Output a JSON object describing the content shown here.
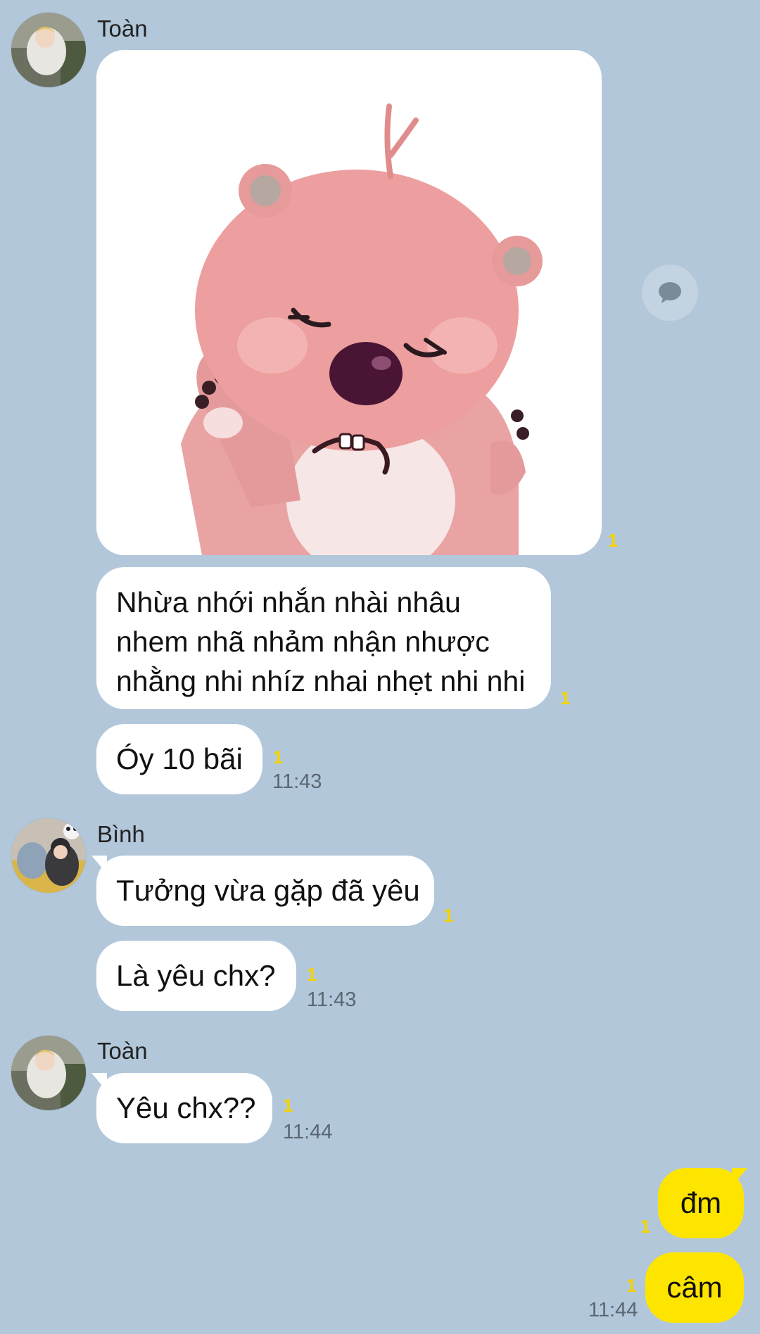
{
  "groups": [
    {
      "sender": "Toàn"
    },
    {
      "sender": "Bình"
    },
    {
      "sender": "Toàn"
    }
  ],
  "messages": {
    "toan_sticker": {
      "unread": "1"
    },
    "toan_text1": {
      "lines": [
        "Nhừa nhới nhắn nhài nhâu",
        "nhem nhã nhảm nhận nhược",
        "nhằng nhi nhíz nhai nhẹt nhi nhi"
      ],
      "unread": "1"
    },
    "toan_text2": {
      "text": "Óy 10 bãi",
      "unread": "1",
      "time": "11:43"
    },
    "binh_text1": {
      "text": "Tưởng vừa gặp đã yêu",
      "unread": "1"
    },
    "binh_text2": {
      "text": "Là yêu chx?",
      "unread": "1",
      "time": "11:43"
    },
    "toan_text3": {
      "text": "Yêu chx??",
      "unread": "1",
      "time": "11:44"
    },
    "me_text1": {
      "text": "đm",
      "unread": "1"
    },
    "me_text2": {
      "text": "câm",
      "unread": "1",
      "time": "11:44"
    }
  },
  "colors": {
    "background": "#b2c7da",
    "my_bubble": "#fee500",
    "other_bubble": "#ffffff",
    "unread": "#f5d400"
  },
  "icons": {
    "reply": "speech-bubble-icon"
  }
}
